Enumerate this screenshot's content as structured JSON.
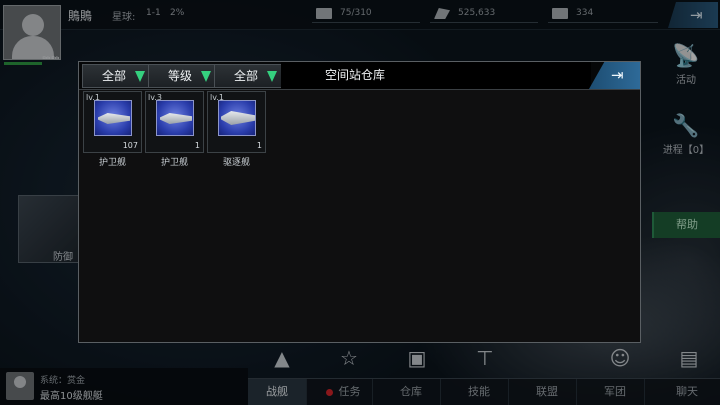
{
  "header": {
    "player_name": "鵙鵙",
    "avatar_name": "鵙鵙",
    "star_label": "星球:",
    "star_value": "1-1",
    "star_pct": "2%",
    "resources": [
      {
        "icon": "energy-icon",
        "value": "75/310"
      },
      {
        "icon": "credits-icon",
        "value": "525,633"
      },
      {
        "icon": "crystal-icon",
        "value": "334"
      }
    ]
  },
  "right_panel": {
    "activity": "活动",
    "progress": "进程【0】",
    "help": "帮助"
  },
  "left_card": {
    "label": "防御"
  },
  "warehouse": {
    "filters": [
      "全部",
      "等级",
      "全部"
    ],
    "title": "空间站仓库",
    "items": [
      {
        "level": "lv.1",
        "count": "107",
        "name": "护卫舰"
      },
      {
        "level": "lv.3",
        "count": "1",
        "name": "护卫舰"
      },
      {
        "level": "lv.1",
        "count": "1",
        "name": "驱逐舰"
      }
    ]
  },
  "chat": {
    "line1": "系统：赏金",
    "line2": "最高10级舰艇"
  },
  "bottom_tabs": [
    "战舰",
    "任务",
    "仓库",
    "技能",
    "联盟",
    "军团",
    "聊天"
  ],
  "colors": {
    "accent_blue": "#2e6a98",
    "filter_arrow": "#35d07f",
    "task_dot": "#d4242a",
    "help_green": "#1f5e3a"
  }
}
